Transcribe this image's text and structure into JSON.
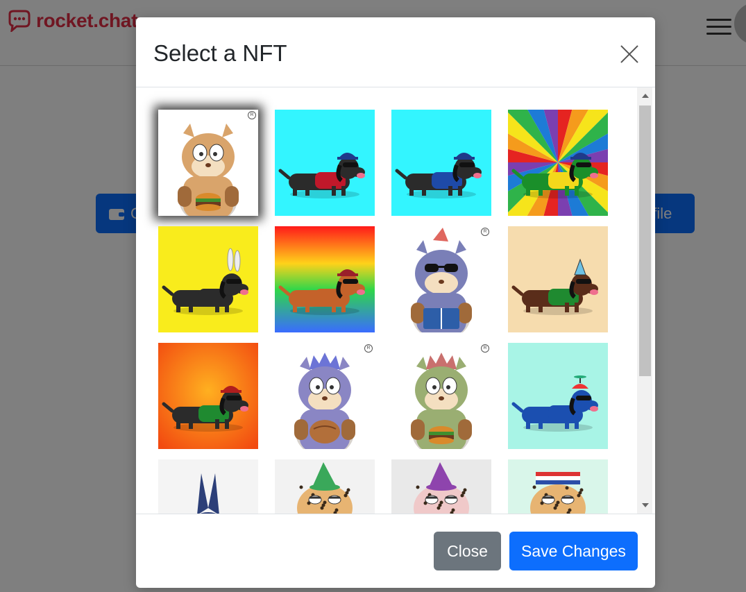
{
  "app": {
    "logo_text": "rocket.chat"
  },
  "background": {
    "left_button_label": "C",
    "right_button_label": "ofile"
  },
  "modal": {
    "title": "Select a NFT",
    "close_icon": "close-icon",
    "footer": {
      "close_label": "Close",
      "save_label": "Save Changes"
    },
    "nfts": [
      {
        "kind": "hamster",
        "bg": "#ffffff",
        "fur": "#d9a46b",
        "item": "burger",
        "selected": true,
        "reg": true
      },
      {
        "kind": "dog",
        "bg": "#33f5ff",
        "body": "#2b2b2b",
        "shirt": "#c0182a",
        "hat": "#1f3a8a"
      },
      {
        "kind": "dog",
        "bg": "#33f5ff",
        "body": "#2b2b2b",
        "shirt": "#1e4aa8",
        "hat": "#1f3a8a"
      },
      {
        "kind": "dog",
        "bg": "rainbow",
        "body": "#1a8f2a",
        "shirt": "#f3d81b",
        "hat": "#1f3a8a"
      },
      {
        "kind": "dog",
        "bg": "#f9ec1c",
        "body": "#2b2b2b",
        "shirt": "#2b2b2b",
        "hat": "bunny"
      },
      {
        "kind": "dog",
        "bg": "gradient-rainbow",
        "body": "#c4622a",
        "shirt": "#c4622a",
        "hat": "#9a1f2a"
      },
      {
        "kind": "hamster",
        "bg": "#ffffff",
        "fur": "#7a7fb7",
        "item": "book",
        "reg": true
      },
      {
        "kind": "dog",
        "bg": "#f6dcae",
        "body": "#5a2d1a",
        "shirt": "#1f8a30",
        "hat": "party"
      },
      {
        "kind": "dog",
        "bg": "orange",
        "body": "#2b2b2b",
        "shirt": "#1f8a30",
        "hat": "#b01d1d"
      },
      {
        "kind": "hamster",
        "bg": "#ffffff",
        "fur": "#8a86c4",
        "item": "nut",
        "reg": true
      },
      {
        "kind": "hamster",
        "bg": "#ffffff",
        "fur": "#9aae72",
        "item": "burger",
        "reg": true
      },
      {
        "kind": "dog",
        "bg": "#a8f4e6",
        "body": "#1b4fb0",
        "shirt": "#1b4fb0",
        "hat": "propeller"
      },
      {
        "kind": "ears",
        "bg": "#f4f4f4"
      },
      {
        "kind": "leopard",
        "bg": "#f2f2f2",
        "hat": "#3aa85a"
      },
      {
        "kind": "leopard",
        "bg": "#e9e9e9",
        "hat": "#8e44ad",
        "fur": "#f0c9c9"
      },
      {
        "kind": "leopard",
        "bg": "#d9f6ea",
        "hat": "stripes"
      }
    ]
  },
  "scrollbar": {
    "position_fraction": 0
  },
  "colors": {
    "primary": "#0d6efd",
    "secondary": "#6c757d",
    "brand": "#e02d44"
  }
}
